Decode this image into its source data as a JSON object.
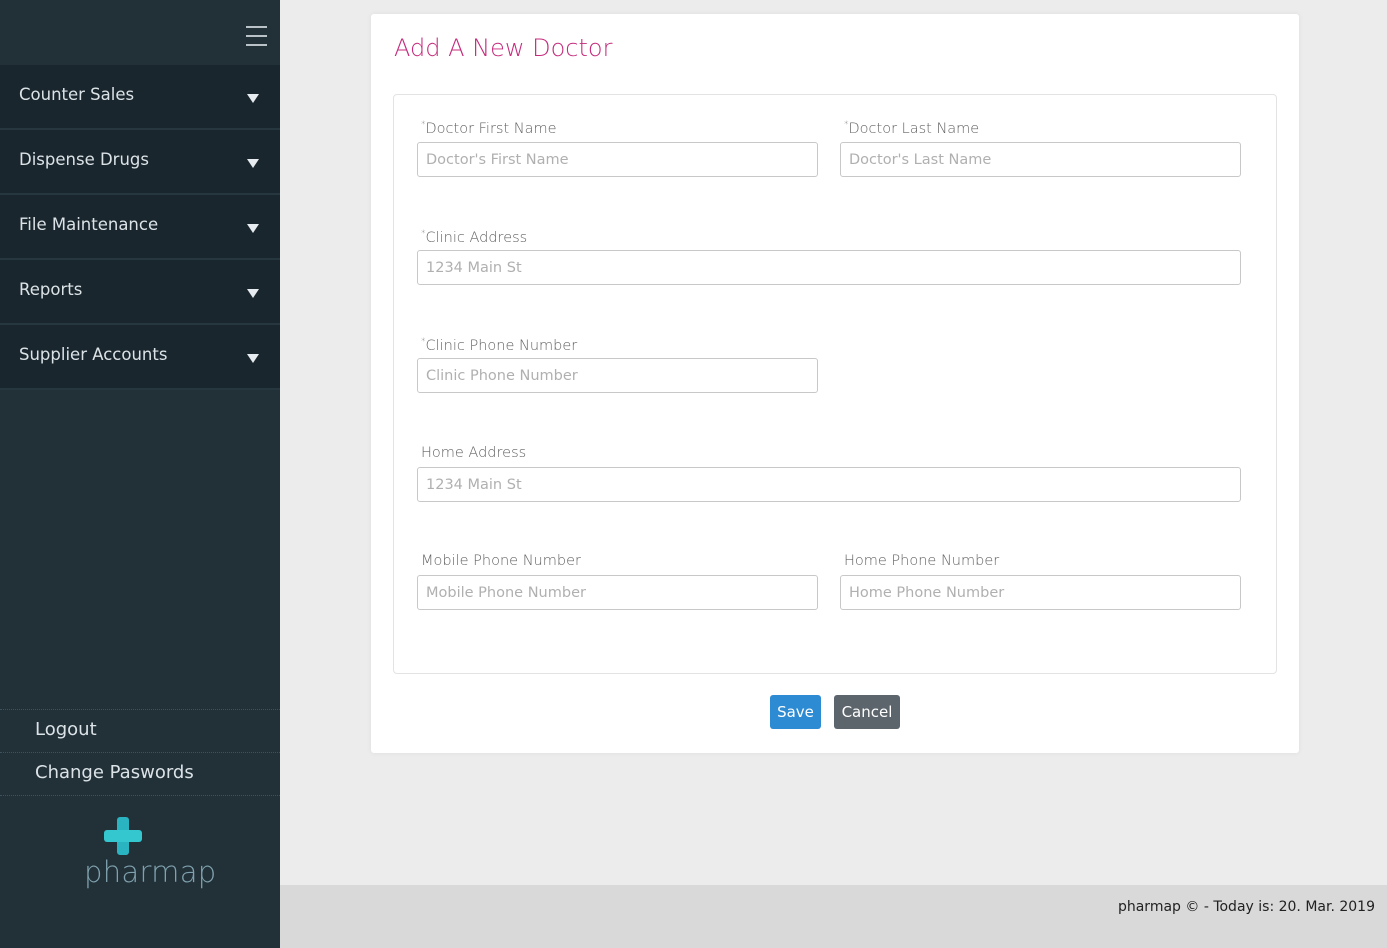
{
  "sidebar": {
    "menu_icon": "hamburger-icon",
    "items": [
      {
        "label": "Counter Sales",
        "icon": "caret-down-icon"
      },
      {
        "label": "Dispense Drugs",
        "icon": "caret-down-icon"
      },
      {
        "label": "File Maintenance",
        "icon": "caret-down-icon"
      },
      {
        "label": "Reports",
        "icon": "caret-down-icon"
      },
      {
        "label": "Supplier Accounts",
        "icon": "caret-down-icon"
      }
    ],
    "bottom_links": [
      {
        "label": "Logout"
      },
      {
        "label": "Change Paswords"
      }
    ],
    "logo_text": "pharmap"
  },
  "form": {
    "title": "Add A New Doctor",
    "required_mark": "*",
    "fields": {
      "first_name": {
        "label": "Doctor First Name",
        "placeholder": "Doctor's First Name",
        "value": ""
      },
      "last_name": {
        "label": "Doctor Last Name",
        "placeholder": "Doctor's Last Name",
        "value": ""
      },
      "clinic_address": {
        "label": "Clinic Address",
        "placeholder": "1234 Main St",
        "value": ""
      },
      "clinic_phone": {
        "label": "Clinic Phone Number",
        "placeholder": "Clinic Phone Number",
        "value": ""
      },
      "home_address": {
        "label": "Home Address",
        "placeholder": "1234 Main St",
        "value": ""
      },
      "mobile_phone": {
        "label": "Mobile Phone Number",
        "placeholder": "Mobile Phone Number",
        "value": ""
      },
      "home_phone": {
        "label": "Home Phone Number",
        "placeholder": "Home Phone Number",
        "value": ""
      }
    },
    "save_label": "Save",
    "cancel_label": "Cancel"
  },
  "footer": {
    "text": "pharmap © - Today is: 20. Mar. 2019"
  },
  "colors": {
    "sidebar_bg": "#223038",
    "title": "#c42b7b",
    "save": "#2d8bd3",
    "cancel": "#5d656c",
    "logo_cross": "#35c7cf"
  }
}
